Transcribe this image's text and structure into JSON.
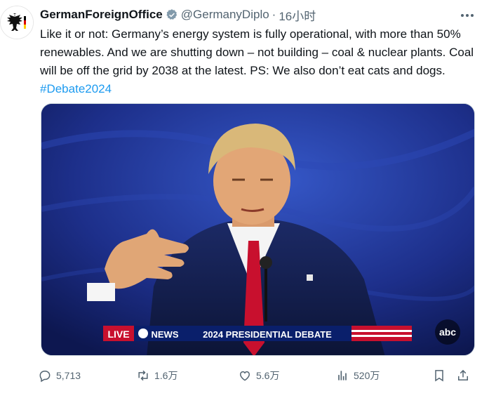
{
  "author": {
    "display_name": "GermanForeignOffice",
    "handle": "@GermanyDiplo",
    "separator": "·",
    "time": "16小时"
  },
  "post": {
    "text_main": "Like it or not: Germany’s energy system is fully operational, with more than 50% renewables. And we are shutting down – not building – coal & nuclear plants. Coal will be off the grid by 2038 at the latest. PS: We also don’t eat cats and dogs. ",
    "hashtag": "#Debate2024"
  },
  "media": {
    "ticker_live": "LIVE",
    "ticker_network": "NEWS",
    "ticker_headline": "2024 PRESIDENTIAL DEBATE",
    "corner_logo": "abc"
  },
  "actions": {
    "replies": "5,713",
    "reposts": "1.6万",
    "likes": "5.6万",
    "views": "520万"
  },
  "colors": {
    "text": "#0f1419",
    "muted": "#536471",
    "link": "#1d9bf0",
    "ticker_red": "#c8102e",
    "ticker_blue": "#0a1f6b"
  },
  "icons": [
    "verified-badge-icon",
    "more-icon",
    "reply-icon",
    "repost-icon",
    "like-icon",
    "views-icon",
    "bookmark-icon",
    "share-icon",
    "eagle-icon"
  ]
}
